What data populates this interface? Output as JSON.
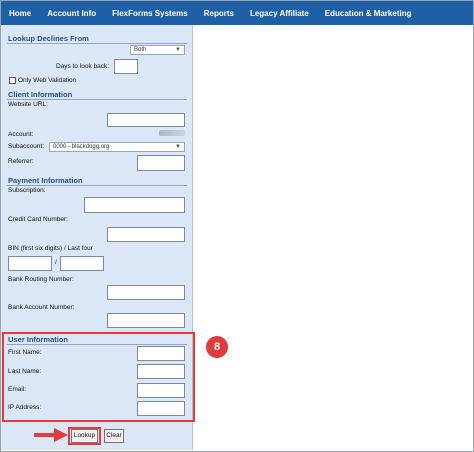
{
  "nav": {
    "items": [
      {
        "label": "Home"
      },
      {
        "label": "Account Info"
      },
      {
        "label": "FlexForms Systems"
      },
      {
        "label": "Reports"
      },
      {
        "label": "Legacy Affiliate"
      },
      {
        "label": "Education & Marketing"
      }
    ]
  },
  "lookup": {
    "title": "Lookup Declines From",
    "select_value": "Both",
    "days_label": "Days to look back:",
    "only_web_label": "Only Web Validation"
  },
  "client": {
    "title": "Client Information",
    "website_label": "Website URL:",
    "account_label": "Account:",
    "subaccount_label": "Subaccount:",
    "subaccount_value": "0000 - blackdogg.org",
    "referrer_label": "Referrer:"
  },
  "payment": {
    "title": "Payment Information",
    "subscription_label": "Subscription:",
    "card_label": "Credit Card Number:",
    "bin_label": "BIN (first six digits) / Last four",
    "bin_sep": "/",
    "routing_label": "Bank Routing Number:",
    "bank_account_label": "Bank Account Number:"
  },
  "user": {
    "title": "User Information",
    "first_label": "First Name:",
    "last_label": "Last Name:",
    "email_label": "Email:",
    "ip_label": "IP Address:"
  },
  "annotation": {
    "step": "8",
    "accent": "#e23b3b"
  },
  "buttons": {
    "lookup": "Lookup",
    "clear": "Clear"
  }
}
